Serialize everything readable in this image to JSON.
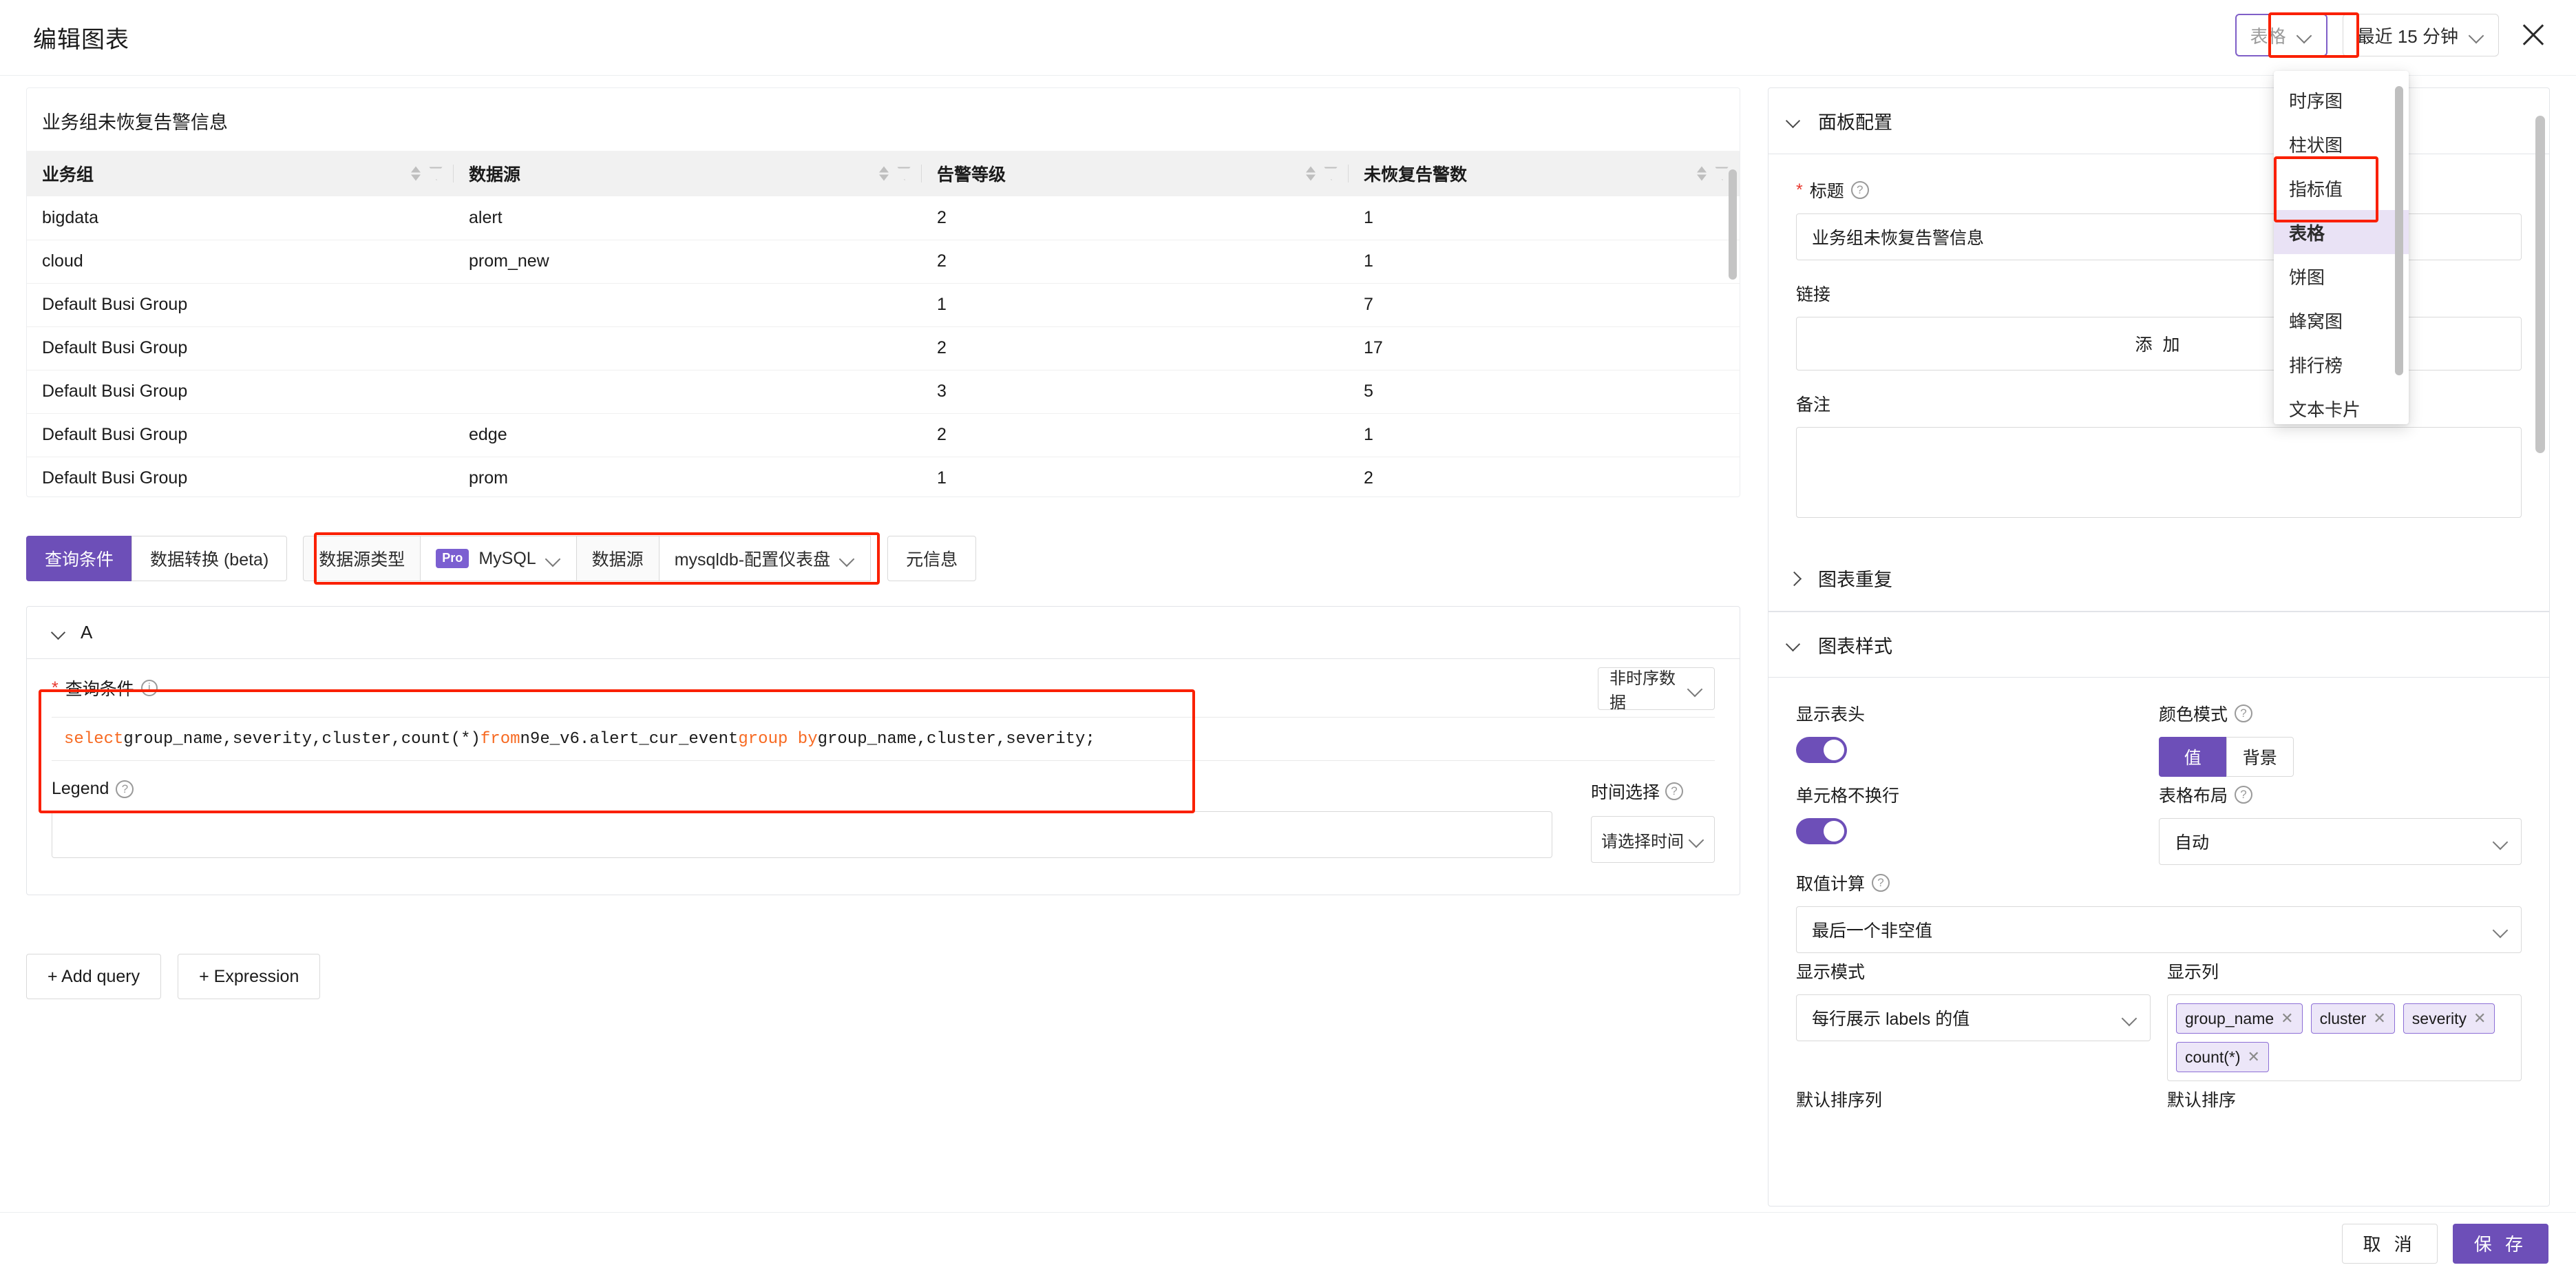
{
  "header": {
    "title": "编辑图表",
    "chart_type_selected": "表格",
    "time_range": "最近 15 分钟",
    "close_icon": "close-icon"
  },
  "chart_type_menu": {
    "items": [
      "时序图",
      "柱状图",
      "指标值",
      "表格",
      "饼图",
      "蜂窝图",
      "排行榜",
      "文本卡片"
    ],
    "selected": "表格"
  },
  "preview": {
    "title": "业务组未恢复告警信息"
  },
  "chart_data": {
    "type": "table",
    "title": "业务组未恢复告警信息",
    "columns": [
      "业务组",
      "数据源",
      "告警等级",
      "未恢复告警数"
    ],
    "rows": [
      [
        "bigdata",
        "alert",
        "2",
        "1"
      ],
      [
        "cloud",
        "prom_new",
        "2",
        "1"
      ],
      [
        "Default Busi Group",
        "",
        "1",
        "7"
      ],
      [
        "Default Busi Group",
        "",
        "2",
        "17"
      ],
      [
        "Default Busi Group",
        "",
        "3",
        "5"
      ],
      [
        "Default Busi Group",
        "edge",
        "2",
        "1"
      ],
      [
        "Default Busi Group",
        "prom",
        "1",
        "2"
      ]
    ],
    "value_colors": {
      "orange": "#f2a03c",
      "red": "#f2566a"
    },
    "severity_color_map": {
      "1": "red",
      "2": "orange",
      "3": "orange"
    },
    "count_color_map": {
      "1": "orange",
      "7": "orange",
      "17": "red",
      "5": "orange",
      "2": "orange"
    }
  },
  "query": {
    "tabs": [
      {
        "label": "查询条件",
        "active": true
      },
      {
        "label": "数据转换 (beta)",
        "active": false
      }
    ],
    "datasource_type_label": "数据源类型",
    "datasource_type_badge": "Pro",
    "datasource_type_value": "MySQL",
    "datasource_label": "数据源",
    "datasource_value": "mysqldb-配置仪表盘",
    "meta_tab": "元信息",
    "section_name": "A",
    "condition_label": "查询条件",
    "sql_parts": [
      {
        "t": "select",
        "kw": true
      },
      {
        "t": " group_name,severity,cluster,count(*) ",
        "kw": false
      },
      {
        "t": "from",
        "kw": true
      },
      {
        "t": " n9e_v6.alert_cur_event ",
        "kw": false
      },
      {
        "t": "group by",
        "kw": true
      },
      {
        "t": " group_name,cluster,severity;",
        "kw": false
      }
    ],
    "sql_text": "select group_name,severity,cluster,count(*) from n9e_v6.alert_cur_event group by group_name,cluster,severity;",
    "timeseries_mode": "非时序数据",
    "legend_label": "Legend",
    "legend_value": "",
    "time_select_label": "时间选择",
    "time_select_value": "请选择时间",
    "add_query": "+ Add query",
    "add_expression": "+ Expression"
  },
  "panel_config": {
    "section_title": "面板配置",
    "title_label": "标题",
    "title_value": "业务组未恢复告警信息",
    "link_label": "链接",
    "link_add_button": "添 加",
    "remark_label": "备注",
    "remark_value": "",
    "repeat_section": "图表重复"
  },
  "chart_style": {
    "section_title": "图表样式",
    "show_header_label": "显示表头",
    "show_header_on": true,
    "color_mode_label": "颜色模式",
    "color_mode_options": [
      "值",
      "背景"
    ],
    "color_mode_selected": "值",
    "nowrap_label": "单元格不换行",
    "nowrap_on": true,
    "table_layout_label": "表格布局",
    "table_layout_value": "自动",
    "agg_label": "取值计算",
    "agg_value": "最后一个非空值",
    "display_mode_label": "显示模式",
    "display_mode_value": "每行展示 labels 的值",
    "display_columns_label": "显示列",
    "display_columns": [
      "group_name",
      "cluster",
      "severity",
      "count(*)"
    ],
    "default_sort_col_label": "默认排序列",
    "default_sort_label": "默认排序"
  },
  "footer": {
    "cancel": "取 消",
    "save": "保 存"
  },
  "colors": {
    "accent": "#6d4fb8",
    "highlight_border": "#fa2000",
    "sql_keyword": "#f76a22"
  }
}
